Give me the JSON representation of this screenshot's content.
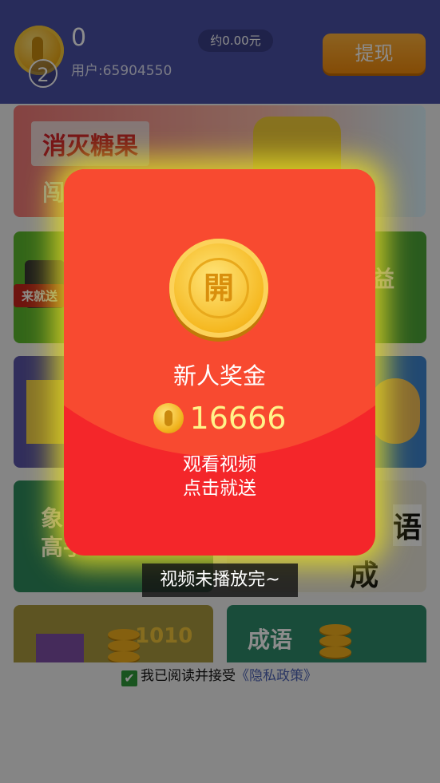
{
  "header": {
    "coins": "0",
    "badge_number": "2",
    "user_id": "用户:65904550",
    "approx_value": "约0.00元",
    "withdraw_label": "提现"
  },
  "cards": {
    "candy_title": "消灭糖果",
    "candy_sub": "闯",
    "phone_tag": "来就送",
    "right_partial_1": "益",
    "chess_partial": "象\n高手",
    "idiom_char_1": "语",
    "idiom_char_2": "成",
    "game_1010": "1010",
    "idiom_title": "成语"
  },
  "footer": {
    "consent_text": "我已阅读并接受",
    "policy_link": "《隐私政策》"
  },
  "modal": {
    "open_char": "開",
    "bonus_title": "新人奖金",
    "amount": "16666",
    "watch_text": "观看视频",
    "click_text": "点击就送"
  },
  "toast": "视频未播放完~",
  "colors": {
    "header_bg": "#4a50a6",
    "envelope_red": "#f4262a",
    "gold": "#f5b820",
    "withdraw_orange": "#f08a0c"
  }
}
